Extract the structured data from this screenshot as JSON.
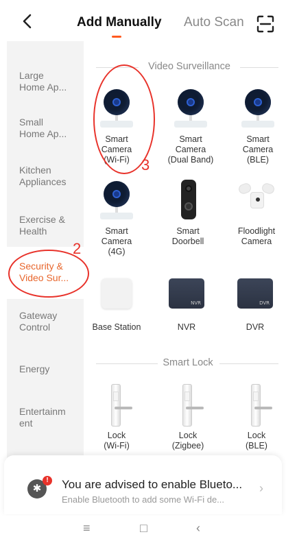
{
  "header": {
    "back_icon": "back-chevron-icon",
    "tabs": [
      {
        "label": "Add Manually",
        "active": true
      },
      {
        "label": "Auto Scan",
        "active": false
      }
    ],
    "scan_icon": "scan-frame-icon",
    "accent_color": "#ff5a1f"
  },
  "sidebar": {
    "items": [
      {
        "label": "Large\nHome Ap..."
      },
      {
        "label": "Small\nHome Ap..."
      },
      {
        "label": "Kitchen\nAppliances"
      },
      {
        "label": "Exercise &\nHealth"
      },
      {
        "label": "Security &\nVideo Sur...",
        "active": true
      },
      {
        "label": "Gateway\nControl"
      },
      {
        "label": "Energy"
      },
      {
        "label": "Entertainm\nent"
      }
    ],
    "active_color": "#e8662c"
  },
  "sections": {
    "video": {
      "title": "Video Surveillance",
      "devices": [
        {
          "label": "Smart\nCamera\n(Wi-Fi)",
          "icon": "camera-icon"
        },
        {
          "label": "Smart\nCamera\n(Dual Band)",
          "icon": "camera-icon"
        },
        {
          "label": "Smart\nCamera\n(BLE)",
          "icon": "camera-icon"
        },
        {
          "label": "Smart\nCamera\n(4G)",
          "icon": "camera-icon"
        },
        {
          "label": "Smart\nDoorbell",
          "icon": "doorbell-icon"
        },
        {
          "label": "Floodlight\nCamera",
          "icon": "floodlight-icon"
        },
        {
          "label": "Base Station",
          "icon": "base-station-icon"
        },
        {
          "label": "NVR",
          "icon": "nvr-icon",
          "tag": "NVR"
        },
        {
          "label": "DVR",
          "icon": "dvr-icon",
          "tag": "DVR"
        }
      ]
    },
    "lock": {
      "title": "Smart Lock",
      "devices": [
        {
          "label": "Lock\n(Wi-Fi)",
          "icon": "lock-icon"
        },
        {
          "label": "Lock\n(Zigbee)",
          "icon": "lock-icon"
        },
        {
          "label": "Lock\n(BLE)",
          "icon": "lock-icon"
        }
      ]
    }
  },
  "annotations": {
    "step2": "2",
    "step3": "3",
    "color": "#e8322a"
  },
  "banner": {
    "icon": "bluetooth-icon",
    "badge": "!",
    "title": "You are advised to enable Blueto...",
    "subtitle": "Enable Bluetooth to add some Wi-Fi de...",
    "chevron": "›"
  },
  "navbar": {
    "menu": "≡",
    "home": "□",
    "back": "‹"
  }
}
